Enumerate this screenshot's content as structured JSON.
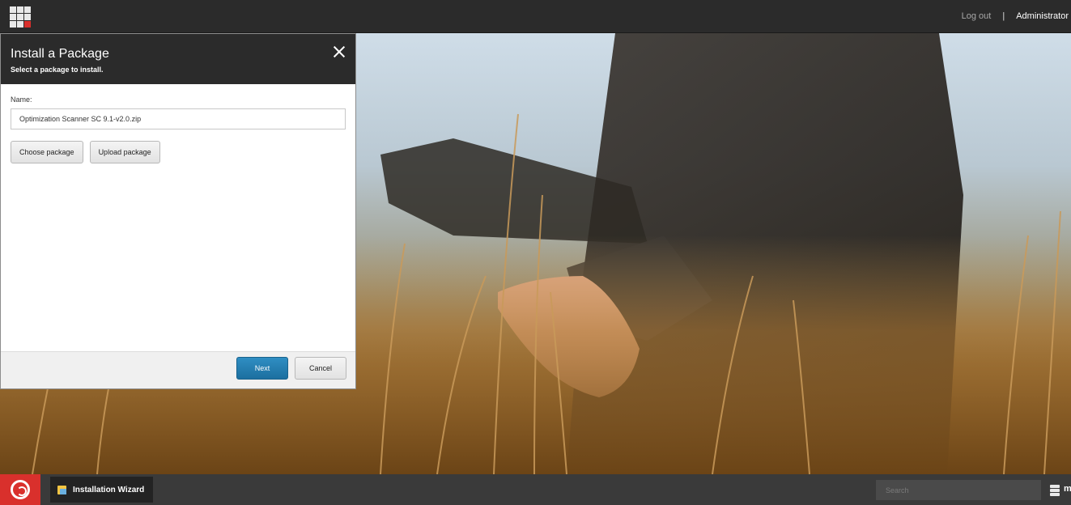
{
  "topbar": {
    "logout_label": "Log out",
    "separator": "|",
    "user_label": "Administrator"
  },
  "dialog": {
    "title": "Install a Package",
    "subtitle": "Select a package to install.",
    "name_label": "Name:",
    "name_value": "Optimization Scanner SC 9.1-v2.0.zip",
    "choose_label": "Choose package",
    "upload_label": "Upload package",
    "next_label": "Next",
    "cancel_label": "Cancel"
  },
  "taskbar": {
    "task_label": "Installation Wizard",
    "search_placeholder": "Search",
    "extra_label": "m"
  },
  "colors": {
    "accent": "#d9302c",
    "primary_button": "#1e7db4",
    "dark_bar": "#2b2b2b"
  }
}
